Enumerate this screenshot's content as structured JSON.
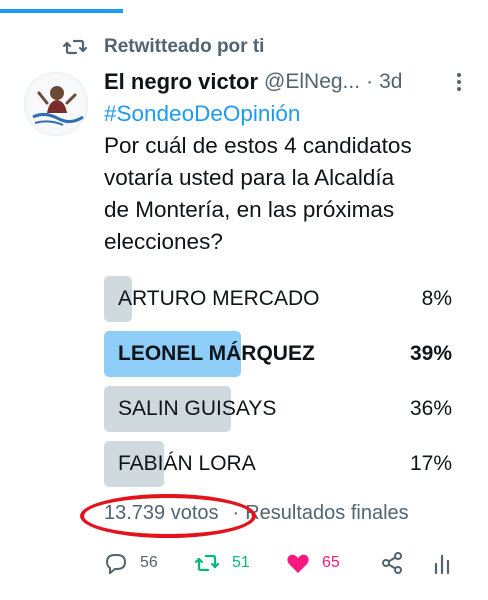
{
  "retweet_banner": {
    "label": "Retwitteado por ti",
    "icon": "retweet-icon"
  },
  "author": {
    "name": "El negro victor",
    "handle": "@ElNeg...",
    "separator": "·",
    "time": "3d",
    "avatar_text": "El Negro Víctor"
  },
  "tweet": {
    "hashtag": "#SondeoDeOpinión",
    "lines": [
      "Por cuál de estos 4 candidatos",
      "votaría usted para la Alcaldía",
      "de Montería, en las próximas",
      "elecciones?"
    ]
  },
  "poll": {
    "options": [
      {
        "label": "ARTURO MERCADO",
        "percent_text": "8%",
        "percent": 8,
        "winner": false
      },
      {
        "label": "LEONEL MÁRQUEZ",
        "percent_text": "39%",
        "percent": 39,
        "winner": true
      },
      {
        "label": "SALIN GUISAYS",
        "percent_text": "36%",
        "percent": 36,
        "winner": false
      },
      {
        "label": "FABIÁN LORA",
        "percent_text": "17%",
        "percent": 17,
        "winner": false
      }
    ],
    "votes": "13.739 votos",
    "separator": "·",
    "status": "Resultados finales"
  },
  "actions": {
    "reply_count": "56",
    "retweet_count": "51",
    "like_count": "65"
  },
  "colors": {
    "accent": "#1d9bf0",
    "poll_fill": "#cfd9de",
    "poll_winner_fill": "#8ecdf8",
    "retweet": "#00ba7c",
    "like": "#f91880",
    "annotation": "#e3121b"
  }
}
